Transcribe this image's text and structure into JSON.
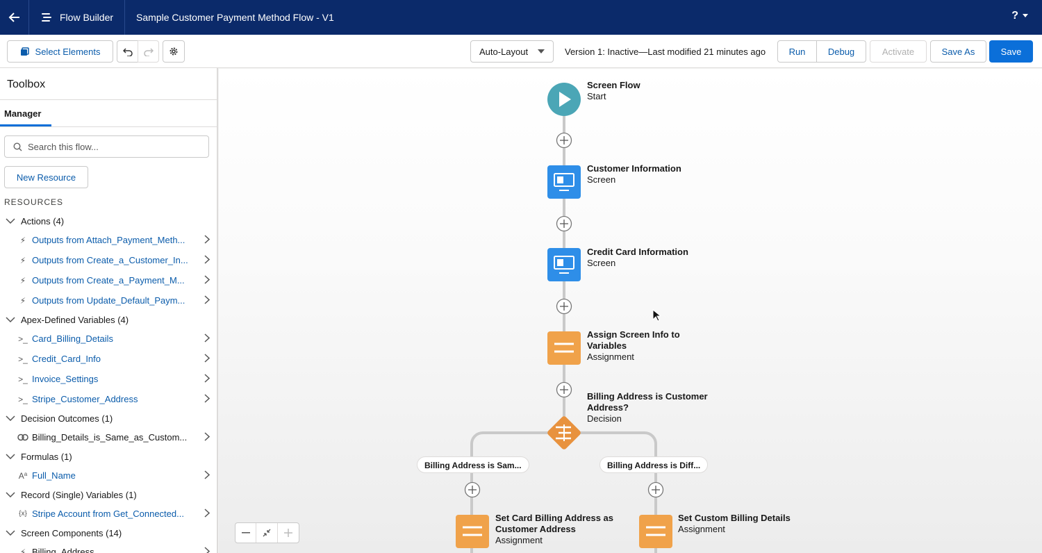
{
  "topbar": {
    "app_name": "Flow Builder",
    "flow_title": "Sample Customer Payment Method Flow - V1",
    "help_label": "?"
  },
  "toolbar": {
    "select_elements": "Select Elements",
    "layout_select": "Auto-Layout",
    "version_status": "Version 1: Inactive—Last modified 21 minutes ago",
    "run": "Run",
    "debug": "Debug",
    "activate": "Activate",
    "save_as": "Save As",
    "save": "Save"
  },
  "sidebar": {
    "title": "Toolbox",
    "tab": "Manager",
    "search_placeholder": "Search this flow...",
    "new_resource": "New Resource",
    "resources_heading": "RESOURCES",
    "groups": [
      {
        "label": "Actions (4)",
        "items": [
          {
            "icon": "bolt-icon",
            "label": "Outputs from Attach_Payment_Meth..."
          },
          {
            "icon": "bolt-icon",
            "label": "Outputs from Create_a_Customer_In..."
          },
          {
            "icon": "bolt-icon",
            "label": "Outputs from Create_a_Payment_M..."
          },
          {
            "icon": "bolt-icon",
            "label": "Outputs from Update_Default_Paym..."
          }
        ]
      },
      {
        "label": "Apex-Defined Variables (4)",
        "items": [
          {
            "icon": "variable-icon",
            "label": "Card_Billing_Details"
          },
          {
            "icon": "variable-icon",
            "label": "Credit_Card_Info"
          },
          {
            "icon": "variable-icon",
            "label": "Invoice_Settings"
          },
          {
            "icon": "variable-icon",
            "label": "Stripe_Customer_Address"
          }
        ]
      },
      {
        "label": "Decision Outcomes (1)",
        "items": [
          {
            "icon": "outcome-icon",
            "label": "Billing_Details_is_Same_as_Custom..."
          }
        ]
      },
      {
        "label": "Formulas (1)",
        "items": [
          {
            "icon": "formula-icon",
            "label": "Full_Name"
          }
        ]
      },
      {
        "label": "Record (Single) Variables (1)",
        "items": [
          {
            "icon": "record-variable-icon",
            "label": "Stripe Account from Get_Connected..."
          }
        ]
      },
      {
        "label": "Screen Components (14)",
        "items": [
          {
            "icon": "bolt-icon",
            "label": "Billing_Address"
          }
        ]
      }
    ]
  },
  "canvas": {
    "start": {
      "title": "Screen Flow",
      "subtitle": "Start"
    },
    "screen1": {
      "title": "Customer Information",
      "subtitle": "Screen"
    },
    "screen2": {
      "title": "Credit Card Information",
      "subtitle": "Screen"
    },
    "assign1": {
      "title_line1": "Assign Screen Info to",
      "title_line2": "Variables",
      "subtitle": "Assignment"
    },
    "decision": {
      "title_line1": "Billing Address is Customer",
      "title_line2": "Address?",
      "subtitle": "Decision"
    },
    "outcome_left": "Billing Address is Sam...",
    "outcome_right": "Billing Address is Diff...",
    "assign2": {
      "title_line1": "Set Card Billing Address as",
      "title_line2": "Customer Address",
      "subtitle": "Assignment"
    },
    "assign3": {
      "title": "Set Custom Billing Details",
      "subtitle": "Assignment"
    }
  },
  "colors": {
    "topbar": "#0b2a6a",
    "start_node": "#4ba6b6",
    "screen_node": "#2e8ee8",
    "assignment_node": "#f0a24a",
    "decision_node": "#e8923e",
    "brand_blue": "#0b6fd9"
  }
}
